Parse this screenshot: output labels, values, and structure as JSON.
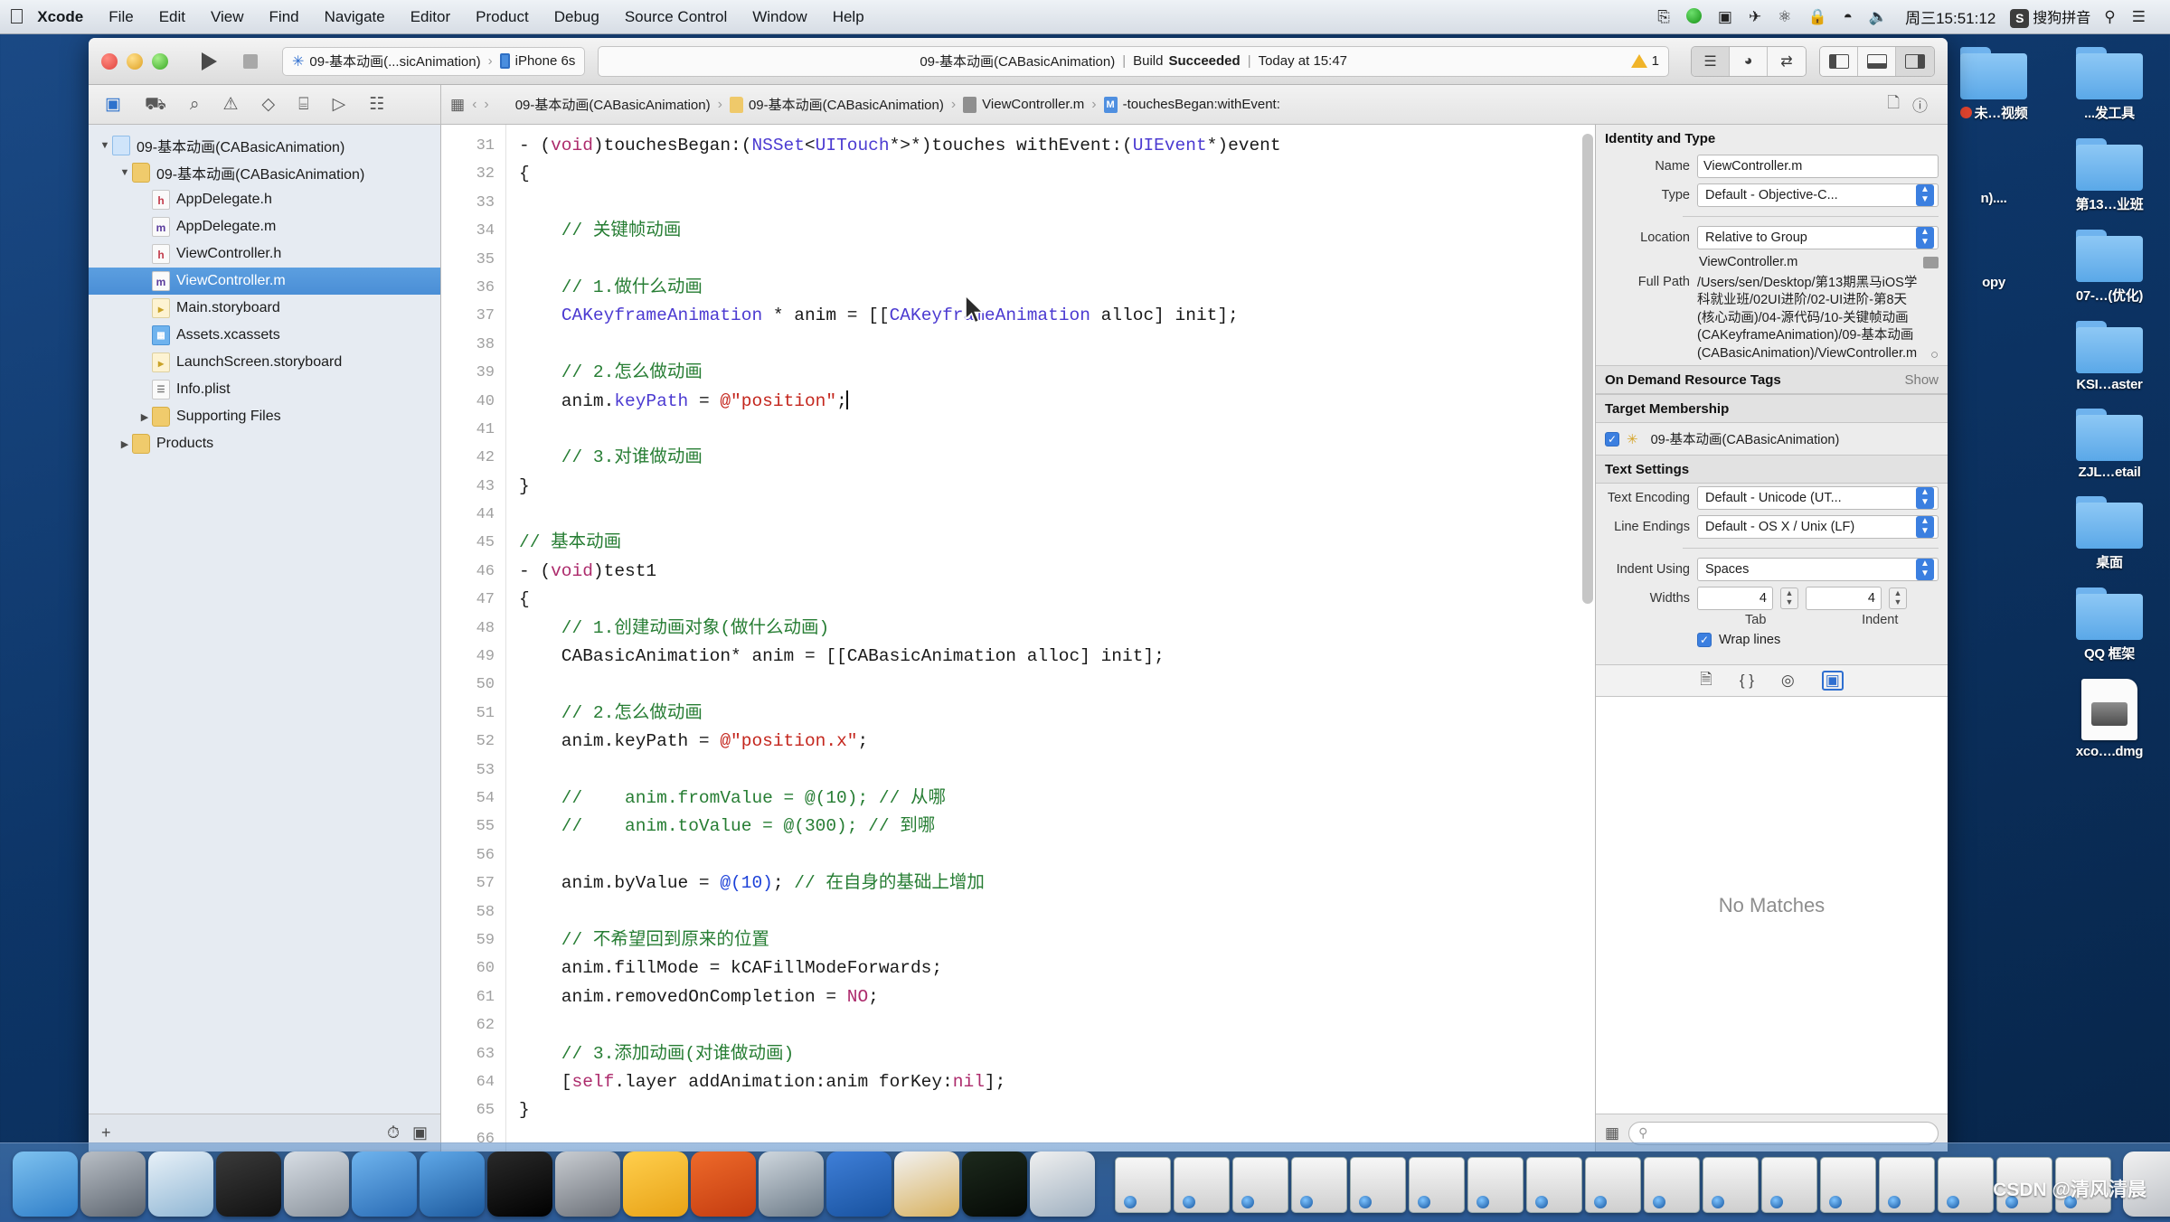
{
  "menubar": {
    "apple": "apple-logo",
    "items": [
      {
        "label": "Xcode",
        "bold": true
      },
      {
        "label": "File",
        "bold": false
      },
      {
        "label": "Edit",
        "bold": false
      },
      {
        "label": "View",
        "bold": false
      },
      {
        "label": "Find",
        "bold": false
      },
      {
        "label": "Navigate",
        "bold": false
      },
      {
        "label": "Editor",
        "bold": false
      },
      {
        "label": "Product",
        "bold": false
      },
      {
        "label": "Debug",
        "bold": false
      },
      {
        "label": "Source Control",
        "bold": false
      },
      {
        "label": "Window",
        "bold": false
      },
      {
        "label": "Help",
        "bold": false
      }
    ],
    "right": {
      "airplay_icon": "airplay-icon",
      "record_icon": "screen-record-icon",
      "video_icon": "video-camera-icon",
      "plane_icon": "airplane-icon",
      "bluetooth_icon": "bluetooth-icon",
      "lock_icon": "lock-icon",
      "wifi_icon": "wifi-icon",
      "volume_icon": "volume-icon",
      "clock": "周三15:51:12",
      "ime_badge": "S",
      "ime_label": "搜狗拼音",
      "search_icon": "search-icon",
      "list_icon": "notification-center-icon"
    }
  },
  "toolbar": {
    "run_label": "run-button",
    "stop_label": "stop-button",
    "scheme_name": "09-基本动画(...sicAnimation)",
    "scheme_device": "iPhone 6s",
    "status_project": "09-基本动画(CABasicAnimation)",
    "status_sep": "|",
    "status_build": "Build",
    "status_result": "Succeeded",
    "status_time": "Today at 15:47",
    "warning_count": "1",
    "editor_segments": [
      "standard-editor",
      "assistant-editor",
      "version-editor"
    ],
    "view_segments": [
      "navigator-toggle",
      "debug-toggle",
      "utilities-toggle"
    ]
  },
  "navbar": {
    "tabs": [
      {
        "name": "project-navigator",
        "glyph": "▣",
        "active": true
      },
      {
        "name": "symbol-navigator",
        "glyph": "⛟",
        "active": false
      },
      {
        "name": "find-navigator",
        "glyph": "⌕",
        "active": false
      },
      {
        "name": "issue-navigator",
        "glyph": "⚠",
        "active": false
      },
      {
        "name": "test-navigator",
        "glyph": "◇",
        "active": false
      },
      {
        "name": "debug-navigator",
        "glyph": "⌸",
        "active": false
      },
      {
        "name": "breakpoint-navigator",
        "glyph": "▷",
        "active": false
      },
      {
        "name": "report-navigator",
        "glyph": "☷",
        "active": false
      }
    ],
    "grid_icon": "related-items-icon",
    "back_icon": "‹",
    "forward_icon": "›",
    "breadcrumbs": [
      {
        "label": "09-基本动画(CABasicAnimation)",
        "icon": "project"
      },
      {
        "label": "09-基本动画(CABasicAnimation)",
        "icon": "folder"
      },
      {
        "label": "ViewController.m",
        "icon": "m"
      },
      {
        "label": "-touchesBegan:withEvent:",
        "icon": "mm"
      }
    ],
    "right_icons": [
      "add-editor-icon",
      "help-icon"
    ]
  },
  "navigator": {
    "tree": [
      {
        "indent": 0,
        "twisty": "▼",
        "icon": "proj",
        "glyph": "",
        "label": "09-基本动画(CABasicAnimation)",
        "selected": false
      },
      {
        "indent": 1,
        "twisty": "▼",
        "icon": "folder",
        "glyph": "",
        "label": "09-基本动画(CABasicAnimation)",
        "selected": false
      },
      {
        "indent": 2,
        "twisty": "",
        "icon": "h",
        "glyph": "h",
        "label": "AppDelegate.h",
        "selected": false
      },
      {
        "indent": 2,
        "twisty": "",
        "icon": "m",
        "glyph": "m",
        "label": "AppDelegate.m",
        "selected": false
      },
      {
        "indent": 2,
        "twisty": "",
        "icon": "h",
        "glyph": "h",
        "label": "ViewController.h",
        "selected": false
      },
      {
        "indent": 2,
        "twisty": "",
        "icon": "m",
        "glyph": "m",
        "label": "ViewController.m",
        "selected": true
      },
      {
        "indent": 2,
        "twisty": "",
        "icon": "sb",
        "glyph": "▸",
        "label": "Main.storyboard",
        "selected": false
      },
      {
        "indent": 2,
        "twisty": "",
        "icon": "xa",
        "glyph": "▦",
        "label": "Assets.xcassets",
        "selected": false
      },
      {
        "indent": 2,
        "twisty": "",
        "icon": "sb",
        "glyph": "▸",
        "label": "LaunchScreen.storyboard",
        "selected": false
      },
      {
        "indent": 2,
        "twisty": "",
        "icon": "pl",
        "glyph": "☰",
        "label": "Info.plist",
        "selected": false
      },
      {
        "indent": 2,
        "twisty": "▶",
        "icon": "folder",
        "glyph": "",
        "label": "Supporting Files",
        "selected": false
      },
      {
        "indent": 1,
        "twisty": "▶",
        "icon": "folder",
        "glyph": "",
        "label": "Products",
        "selected": false
      }
    ],
    "footer": {
      "add_icon": "+",
      "filter_icon": "filter-icon",
      "recent_icon": "recent-files-icon",
      "source_icon": "source-control-icon"
    }
  },
  "editor": {
    "first_line": 31,
    "lines": [
      {
        "n": 31,
        "tokens": [
          {
            "t": "- (",
            "c": ""
          },
          {
            "t": "void",
            "c": "kw"
          },
          {
            "t": ")touchesBegan:(",
            "c": ""
          },
          {
            "t": "NSSet",
            "c": "cls"
          },
          {
            "t": "<",
            "c": ""
          },
          {
            "t": "UITouch",
            "c": "cls"
          },
          {
            "t": "*>*)touches withEvent:(",
            "c": ""
          },
          {
            "t": "UIEvent",
            "c": "cls"
          },
          {
            "t": "*)event",
            "c": ""
          }
        ]
      },
      {
        "n": 32,
        "tokens": [
          {
            "t": "{",
            "c": ""
          }
        ]
      },
      {
        "n": 33,
        "tokens": []
      },
      {
        "n": 34,
        "tokens": [
          {
            "t": "    // 关键帧动画",
            "c": "cm"
          }
        ]
      },
      {
        "n": 35,
        "tokens": []
      },
      {
        "n": 36,
        "tokens": [
          {
            "t": "    // 1.做什么动画",
            "c": "cm"
          }
        ]
      },
      {
        "n": 37,
        "tokens": [
          {
            "t": "    ",
            "c": ""
          },
          {
            "t": "CAKeyframeAnimation",
            "c": "cls"
          },
          {
            "t": " * anim = [[",
            "c": ""
          },
          {
            "t": "CAKeyframeAnimation",
            "c": "cls"
          },
          {
            "t": " alloc] init];",
            "c": ""
          }
        ]
      },
      {
        "n": 38,
        "tokens": []
      },
      {
        "n": 39,
        "tokens": [
          {
            "t": "    // 2.怎么做动画",
            "c": "cm"
          }
        ]
      },
      {
        "n": 40,
        "tokens": [
          {
            "t": "    anim.",
            "c": ""
          },
          {
            "t": "keyPath",
            "c": "prop"
          },
          {
            "t": " = ",
            "c": ""
          },
          {
            "t": "@\"position\"",
            "c": "str"
          },
          {
            "t": ";",
            "c": ""
          },
          {
            "t": "|CARET|",
            "c": ""
          }
        ]
      },
      {
        "n": 41,
        "tokens": []
      },
      {
        "n": 42,
        "tokens": [
          {
            "t": "    // 3.对谁做动画",
            "c": "cm"
          }
        ]
      },
      {
        "n": 43,
        "tokens": [
          {
            "t": "}",
            "c": ""
          }
        ]
      },
      {
        "n": 44,
        "tokens": []
      },
      {
        "n": 45,
        "tokens": [
          {
            "t": "// 基本动画",
            "c": "cm"
          }
        ]
      },
      {
        "n": 46,
        "tokens": [
          {
            "t": "- (",
            "c": ""
          },
          {
            "t": "void",
            "c": "kw"
          },
          {
            "t": ")test1",
            "c": ""
          }
        ]
      },
      {
        "n": 47,
        "tokens": [
          {
            "t": "{",
            "c": ""
          }
        ]
      },
      {
        "n": 48,
        "tokens": [
          {
            "t": "    // 1.创建动画对象(做什么动画)",
            "c": "cm"
          }
        ]
      },
      {
        "n": 49,
        "tokens": [
          {
            "t": "    CABasicAnimation* anim = [[CABasicAnimation alloc] init];",
            "c": ""
          }
        ]
      },
      {
        "n": 50,
        "tokens": []
      },
      {
        "n": 51,
        "tokens": [
          {
            "t": "    // 2.怎么做动画",
            "c": "cm"
          }
        ]
      },
      {
        "n": 52,
        "tokens": [
          {
            "t": "    anim.keyPath = ",
            "c": ""
          },
          {
            "t": "@\"position.x\"",
            "c": "str"
          },
          {
            "t": ";",
            "c": ""
          }
        ]
      },
      {
        "n": 53,
        "tokens": []
      },
      {
        "n": 54,
        "tokens": [
          {
            "t": "    //    anim.fromValue = @(10); // 从哪",
            "c": "cm"
          }
        ]
      },
      {
        "n": 55,
        "tokens": [
          {
            "t": "    //    anim.toValue = @(300); // 到哪",
            "c": "cm"
          }
        ]
      },
      {
        "n": 56,
        "tokens": []
      },
      {
        "n": 57,
        "tokens": [
          {
            "t": "    anim.byValue = ",
            "c": ""
          },
          {
            "t": "@(10)",
            "c": "num"
          },
          {
            "t": "; ",
            "c": ""
          },
          {
            "t": "// 在自身的基础上增加",
            "c": "cm"
          }
        ]
      },
      {
        "n": 58,
        "tokens": []
      },
      {
        "n": 59,
        "tokens": [
          {
            "t": "    // 不希望回到原来的位置",
            "c": "cm"
          }
        ]
      },
      {
        "n": 60,
        "tokens": [
          {
            "t": "    anim.fillMode = kCAFillModeForwards;",
            "c": ""
          }
        ]
      },
      {
        "n": 61,
        "tokens": [
          {
            "t": "    anim.removedOnCompletion = ",
            "c": ""
          },
          {
            "t": "NO",
            "c": "kw"
          },
          {
            "t": ";",
            "c": ""
          }
        ]
      },
      {
        "n": 62,
        "tokens": []
      },
      {
        "n": 63,
        "tokens": [
          {
            "t": "    // 3.添加动画(对谁做动画)",
            "c": "cm"
          }
        ]
      },
      {
        "n": 64,
        "tokens": [
          {
            "t": "    [",
            "c": ""
          },
          {
            "t": "self",
            "c": "kw"
          },
          {
            "t": ".layer addAnimation:anim forKey:",
            "c": ""
          },
          {
            "t": "nil",
            "c": "kw"
          },
          {
            "t": "];",
            "c": ""
          }
        ]
      },
      {
        "n": 65,
        "tokens": [
          {
            "t": "}",
            "c": ""
          }
        ]
      },
      {
        "n": 66,
        "tokens": []
      }
    ]
  },
  "inspector": {
    "identity_title": "Identity and Type",
    "name_label": "Name",
    "name_value": "ViewController.m",
    "type_label": "Type",
    "type_value": "Default - Objective-C...",
    "location_label": "Location",
    "location_value": "Relative to Group",
    "location_file": "ViewController.m",
    "fullpath_label": "Full Path",
    "fullpath_value": "/Users/sen/Desktop/第13期黑马iOS学科就业班/02UI进阶/02-UI进阶-第8天(核心动画)/04-源代码/10-关键帧动画(CAKeyframeAnimation)/09-基本动画(CABasicAnimation)/ViewController.m",
    "odr_title": "On Demand Resource Tags",
    "odr_show": "Show",
    "target_title": "Target Membership",
    "target_item": "09-基本动画(CABasicAnimation)",
    "target_checked": true,
    "text_settings_title": "Text Settings",
    "encoding_label": "Text Encoding",
    "encoding_value": "Default - Unicode (UT...",
    "line_endings_label": "Line Endings",
    "line_endings_value": "Default - OS X / Unix (LF)",
    "indent_label": "Indent Using",
    "indent_value": "Spaces",
    "widths_label": "Widths",
    "tab_width": "4",
    "indent_width": "4",
    "tab_sub": "Tab",
    "indent_sub": "Indent",
    "wrap_label": "Wrap lines",
    "wrap_checked": true,
    "filter_icons": [
      "file-template-icon",
      "code-snippet-icon",
      "object-library-icon",
      "media-library-icon"
    ],
    "results_empty": "No Matches",
    "search_placeholder": ""
  },
  "desktop": {
    "left_column": [
      {
        "label": "...发工具",
        "type": "folder"
      },
      {
        "label": "第13…业班",
        "type": "folder"
      },
      {
        "label": "07-…(优化)",
        "type": "folder"
      },
      {
        "label": "KSI…aster",
        "type": "folder"
      },
      {
        "label": "ZJL…etail",
        "type": "folder"
      },
      {
        "label": "桌面",
        "type": "folder"
      },
      {
        "label": "QQ 框架",
        "type": "folder"
      },
      {
        "label": "xco….dmg",
        "type": "dmg"
      }
    ],
    "right_column": [
      {
        "label": "未…视频",
        "type": "folder",
        "dot": true
      },
      {
        "label": "n)....",
        "type": "none"
      },
      {
        "label": "opy",
        "type": "none"
      }
    ]
  },
  "dock": {
    "apps": [
      {
        "name": "finder",
        "color1": "#7ec2f0",
        "color2": "#2f7ec8"
      },
      {
        "name": "launchpad",
        "color1": "#b9bfc6",
        "color2": "#5e6670"
      },
      {
        "name": "safari",
        "color1": "#e8f1f8",
        "color2": "#8fb6d4"
      },
      {
        "name": "mouse-app",
        "color1": "#3a3a3a",
        "color2": "#111111"
      },
      {
        "name": "photo-booth",
        "color1": "#d8dee5",
        "color2": "#8b939c"
      },
      {
        "name": "xcode-beta",
        "color1": "#6fb4ee",
        "color2": "#2a6cb5"
      },
      {
        "name": "xcode",
        "color1": "#5fa8e8",
        "color2": "#1d5a9e"
      },
      {
        "name": "terminal",
        "color1": "#2a2a2a",
        "color2": "#000000"
      },
      {
        "name": "system-preferences",
        "color1": "#c9cdd2",
        "color2": "#6b7078"
      },
      {
        "name": "sketch",
        "color1": "#ffcf4d",
        "color2": "#e8a216"
      },
      {
        "name": "help-app",
        "color1": "#ee6a2a",
        "color2": "#c43c10"
      },
      {
        "name": "media-player",
        "color1": "#cfd7de",
        "color2": "#6d7b88"
      },
      {
        "name": "chat-app",
        "color1": "#3f7fd8",
        "color2": "#18529f"
      },
      {
        "name": "calendar",
        "color1": "#f2f2f2",
        "color2": "#d8b15e"
      },
      {
        "name": "dark-app",
        "color1": "#1d2a1d",
        "color2": "#050905"
      },
      {
        "name": "chrome",
        "color1": "#f0f0f0",
        "color2": "#9fb0c0"
      }
    ],
    "window_count": 17,
    "trash_name": "trash"
  },
  "watermark": "CSDN @清风清晨"
}
